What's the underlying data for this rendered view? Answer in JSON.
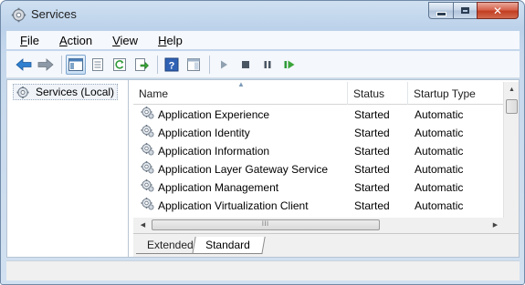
{
  "window": {
    "title": "Services",
    "icon": "gear-icon"
  },
  "menu": [
    {
      "label": "File",
      "accel": "F",
      "rest": "ile"
    },
    {
      "label": "Action",
      "accel": "A",
      "rest": "ction"
    },
    {
      "label": "View",
      "accel": "V",
      "rest": "iew"
    },
    {
      "label": "Help",
      "accel": "H",
      "rest": "elp"
    }
  ],
  "toolbar": {
    "icons": [
      "back-arrow-icon",
      "forward-arrow-icon",
      "show-hide-console-tree-icon",
      "properties-icon",
      "refresh-icon",
      "export-list-icon",
      "help-icon",
      "show-action-pane-icon",
      "start-service-icon",
      "stop-service-icon",
      "pause-service-icon",
      "restart-service-icon"
    ]
  },
  "tree": {
    "root_label": "Services (Local)"
  },
  "list": {
    "columns": {
      "name": "Name",
      "status": "Status",
      "startup": "Startup Type"
    },
    "rows": [
      {
        "name": "Application Experience",
        "status": "Started",
        "startup": "Automatic"
      },
      {
        "name": "Application Identity",
        "status": "Started",
        "startup": "Automatic"
      },
      {
        "name": "Application Information",
        "status": "Started",
        "startup": "Automatic"
      },
      {
        "name": "Application Layer Gateway Service",
        "status": "Started",
        "startup": "Automatic"
      },
      {
        "name": "Application Management",
        "status": "Started",
        "startup": "Automatic"
      },
      {
        "name": "Application Virtualization Client",
        "status": "Started",
        "startup": "Automatic"
      }
    ]
  },
  "tabs": {
    "extended": "Extended",
    "standard": "Standard",
    "active": "Standard"
  },
  "colors": {
    "accent_blue": "#2f6fb7",
    "play_green": "#3aa53a",
    "close_red": "#c23e22"
  }
}
